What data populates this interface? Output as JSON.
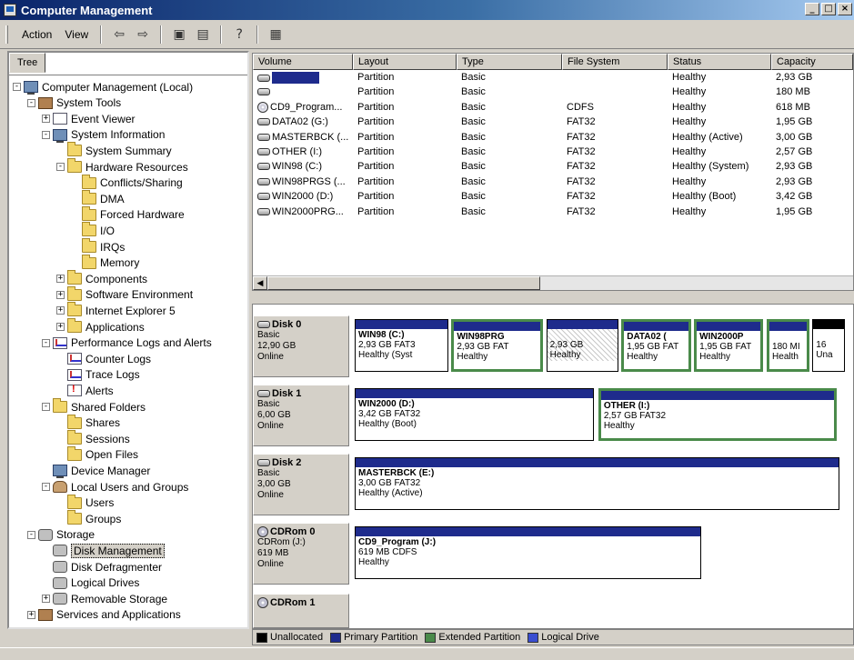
{
  "window": {
    "title": "Computer Management",
    "buttons": [
      "_",
      "□",
      "×"
    ]
  },
  "toolbar": {
    "menus": [
      "Action",
      "View"
    ],
    "tools": [
      "back-icon",
      "forward-icon",
      "up-folder-icon",
      "properties-icon",
      "help-icon",
      "console-icon"
    ]
  },
  "tree": {
    "tab_label": "Tree",
    "items": [
      {
        "label": "Computer Management (Local)",
        "level": 0,
        "expander": "−",
        "icon": "comp"
      },
      {
        "label": "System Tools",
        "level": 1,
        "expander": "−",
        "icon": "tools"
      },
      {
        "label": "Event Viewer",
        "level": 2,
        "expander": "+",
        "icon": "doc"
      },
      {
        "label": "System Information",
        "level": 2,
        "expander": "−",
        "icon": "comp"
      },
      {
        "label": "System Summary",
        "level": 3,
        "expander": "",
        "icon": "folder"
      },
      {
        "label": "Hardware Resources",
        "level": 3,
        "expander": "−",
        "icon": "folder"
      },
      {
        "label": "Conflicts/Sharing",
        "level": 4,
        "expander": "",
        "icon": "folder"
      },
      {
        "label": "DMA",
        "level": 4,
        "expander": "",
        "icon": "folder"
      },
      {
        "label": "Forced Hardware",
        "level": 4,
        "expander": "",
        "icon": "folder"
      },
      {
        "label": "I/O",
        "level": 4,
        "expander": "",
        "icon": "folder"
      },
      {
        "label": "IRQs",
        "level": 4,
        "expander": "",
        "icon": "folder"
      },
      {
        "label": "Memory",
        "level": 4,
        "expander": "",
        "icon": "folder"
      },
      {
        "label": "Components",
        "level": 3,
        "expander": "+",
        "icon": "folder"
      },
      {
        "label": "Software Environment",
        "level": 3,
        "expander": "+",
        "icon": "folder"
      },
      {
        "label": "Internet Explorer 5",
        "level": 3,
        "expander": "+",
        "icon": "folder"
      },
      {
        "label": "Applications",
        "level": 3,
        "expander": "+",
        "icon": "folder"
      },
      {
        "label": "Performance Logs and Alerts",
        "level": 2,
        "expander": "−",
        "icon": "chart"
      },
      {
        "label": "Counter Logs",
        "level": 3,
        "expander": "",
        "icon": "chart"
      },
      {
        "label": "Trace Logs",
        "level": 3,
        "expander": "",
        "icon": "chart"
      },
      {
        "label": "Alerts",
        "level": 3,
        "expander": "",
        "icon": "alert"
      },
      {
        "label": "Shared Folders",
        "level": 2,
        "expander": "−",
        "icon": "folder"
      },
      {
        "label": "Shares",
        "level": 3,
        "expander": "",
        "icon": "folder"
      },
      {
        "label": "Sessions",
        "level": 3,
        "expander": "",
        "icon": "folder"
      },
      {
        "label": "Open Files",
        "level": 3,
        "expander": "",
        "icon": "folder"
      },
      {
        "label": "Device Manager",
        "level": 2,
        "expander": "",
        "icon": "comp"
      },
      {
        "label": "Local Users and Groups",
        "level": 2,
        "expander": "−",
        "icon": "users"
      },
      {
        "label": "Users",
        "level": 3,
        "expander": "",
        "icon": "folder"
      },
      {
        "label": "Groups",
        "level": 3,
        "expander": "",
        "icon": "folder"
      },
      {
        "label": "Storage",
        "level": 1,
        "expander": "−",
        "icon": "disk"
      },
      {
        "label": "Disk Management",
        "level": 2,
        "expander": "",
        "icon": "disk",
        "selected": true
      },
      {
        "label": "Disk Defragmenter",
        "level": 2,
        "expander": "",
        "icon": "disk"
      },
      {
        "label": "Logical Drives",
        "level": 2,
        "expander": "",
        "icon": "disk"
      },
      {
        "label": "Removable Storage",
        "level": 2,
        "expander": "+",
        "icon": "disk"
      },
      {
        "label": "Services and Applications",
        "level": 1,
        "expander": "+",
        "icon": "tools"
      }
    ]
  },
  "volumes": {
    "columns": [
      "Volume",
      "Layout",
      "Type",
      "File System",
      "Status",
      "Capacity"
    ],
    "rows": [
      {
        "volume": "",
        "redacted": true,
        "icon": "drive",
        "layout": "Partition",
        "type": "Basic",
        "fs": "",
        "status": "Healthy",
        "capacity": "2,93 GB"
      },
      {
        "volume": "",
        "redacted": false,
        "icon": "drive",
        "layout": "Partition",
        "type": "Basic",
        "fs": "",
        "status": "Healthy",
        "capacity": "180 MB"
      },
      {
        "volume": "CD9_Program...",
        "icon": "cd",
        "layout": "Partition",
        "type": "Basic",
        "fs": "CDFS",
        "status": "Healthy",
        "capacity": "618 MB"
      },
      {
        "volume": "DATA02 (G:)",
        "icon": "drive",
        "layout": "Partition",
        "type": "Basic",
        "fs": "FAT32",
        "status": "Healthy",
        "capacity": "1,95 GB"
      },
      {
        "volume": "MASTERBCK (...",
        "icon": "drive",
        "layout": "Partition",
        "type": "Basic",
        "fs": "FAT32",
        "status": "Healthy (Active)",
        "capacity": "3,00 GB"
      },
      {
        "volume": "OTHER (I:)",
        "icon": "drive",
        "layout": "Partition",
        "type": "Basic",
        "fs": "FAT32",
        "status": "Healthy",
        "capacity": "2,57 GB"
      },
      {
        "volume": "WIN98 (C:)",
        "icon": "drive",
        "layout": "Partition",
        "type": "Basic",
        "fs": "FAT32",
        "status": "Healthy (System)",
        "capacity": "2,93 GB"
      },
      {
        "volume": "WIN98PRGS (...",
        "icon": "drive",
        "layout": "Partition",
        "type": "Basic",
        "fs": "FAT32",
        "status": "Healthy",
        "capacity": "2,93 GB"
      },
      {
        "volume": "WIN2000 (D:)",
        "icon": "drive",
        "layout": "Partition",
        "type": "Basic",
        "fs": "FAT32",
        "status": "Healthy (Boot)",
        "capacity": "3,42 GB"
      },
      {
        "volume": "WIN2000PRG...",
        "icon": "drive",
        "layout": "Partition",
        "type": "Basic",
        "fs": "FAT32",
        "status": "Healthy",
        "capacity": "1,95 GB"
      }
    ]
  },
  "disks": [
    {
      "name": "Disk 0",
      "kind": "Basic",
      "size": "12,90 GB",
      "state": "Online",
      "icon": "disk",
      "partitions": [
        {
          "title": "WIN98 (C:)",
          "line2": "2,93 GB FAT3",
          "line3": "Healthy (Syst",
          "style": "primary"
        },
        {
          "title": "WIN98PRG",
          "line2": "2,93 GB FAT",
          "line3": "Healthy",
          "style": "ext"
        },
        {
          "title": "",
          "line2": "2,93 GB",
          "line3": "Healthy",
          "style": "hatched"
        },
        {
          "title": "DATA02 (",
          "line2": "1,95 GB FAT",
          "line3": "Healthy",
          "style": "ext"
        },
        {
          "title": "WIN2000P",
          "line2": "1,95 GB FAT",
          "line3": "Healthy",
          "style": "ext"
        },
        {
          "title": "",
          "line2": "180 MI",
          "line3": "Health",
          "style": "ext"
        },
        {
          "title": "",
          "line2": "16",
          "line3": "Una",
          "style": "unalloc"
        }
      ]
    },
    {
      "name": "Disk 1",
      "kind": "Basic",
      "size": "6,00 GB",
      "state": "Online",
      "icon": "disk",
      "partitions": [
        {
          "title": "WIN2000 (D:)",
          "line2": "3,42 GB FAT32",
          "line3": "Healthy (Boot)",
          "style": "primary"
        },
        {
          "title": "OTHER (I:)",
          "line2": "2,57 GB FAT32",
          "line3": "Healthy",
          "style": "ext"
        }
      ]
    },
    {
      "name": "Disk 2",
      "kind": "Basic",
      "size": "3,00 GB",
      "state": "Online",
      "icon": "disk",
      "partitions": [
        {
          "title": "MASTERBCK (E:)",
          "line2": "3,00 GB FAT32",
          "line3": "Healthy (Active)",
          "style": "primary"
        }
      ]
    },
    {
      "name": "CDRom 0",
      "kind": "CDRom (J:)",
      "size": "619 MB",
      "state": "Online",
      "icon": "cd",
      "partitions": [
        {
          "title": "CD9_Program (J:)",
          "line2": "619 MB CDFS",
          "line3": "Healthy",
          "style": "primary"
        }
      ]
    },
    {
      "name": "CDRom 1",
      "kind": "",
      "size": "",
      "state": "",
      "icon": "cd",
      "partitions": []
    }
  ],
  "legend": [
    {
      "label": "Unallocated",
      "color": "#000000"
    },
    {
      "label": "Primary Partition",
      "color": "#1e2b8c"
    },
    {
      "label": "Extended Partition",
      "color": "#4a8a4a"
    },
    {
      "label": "Logical Drive",
      "color": "#3a4ed0"
    }
  ]
}
